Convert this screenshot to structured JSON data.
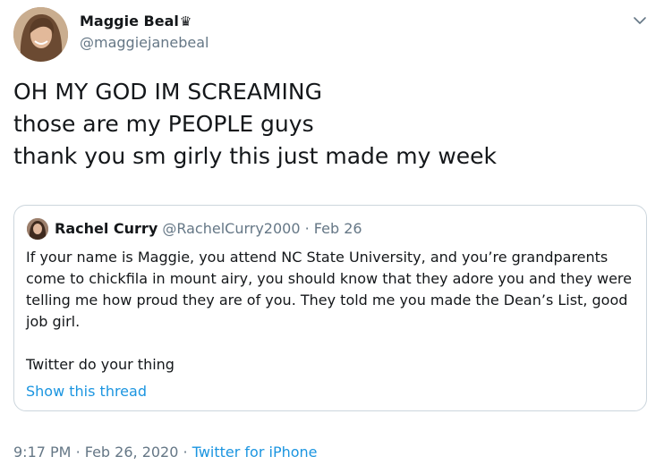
{
  "tweet": {
    "author_name": "Maggie Beal",
    "author_badge_glyph": "♛",
    "author_handle": "@maggiejanebeal",
    "menu_icon": "chevron-down-icon",
    "text_lines": [
      "OH MY GOD IM SCREAMING",
      "those are my PEOPLE guys",
      "thank you sm girly this just made my week"
    ],
    "time": "9:17 PM",
    "separator": "·",
    "date": "Feb 26, 2020",
    "source": "Twitter for iPhone"
  },
  "quoted_tweet": {
    "author_name": "Rachel Curry",
    "author_handle": "@RachelCurry2000",
    "separator": "·",
    "date": "Feb 26",
    "paragraph_1": "If your name is Maggie, you attend NC State University, and you’re grandparents come to chickfila in mount airy, you should know that they adore you and they were telling me how proud they are of you. They told me you made the Dean’s List, good job girl.",
    "paragraph_2": "Twitter do your thing",
    "thread_link": "Show this thread"
  },
  "colors": {
    "text": "#14171a",
    "secondary": "#657786",
    "link": "#1b95e0",
    "border": "#ccd6dd"
  }
}
